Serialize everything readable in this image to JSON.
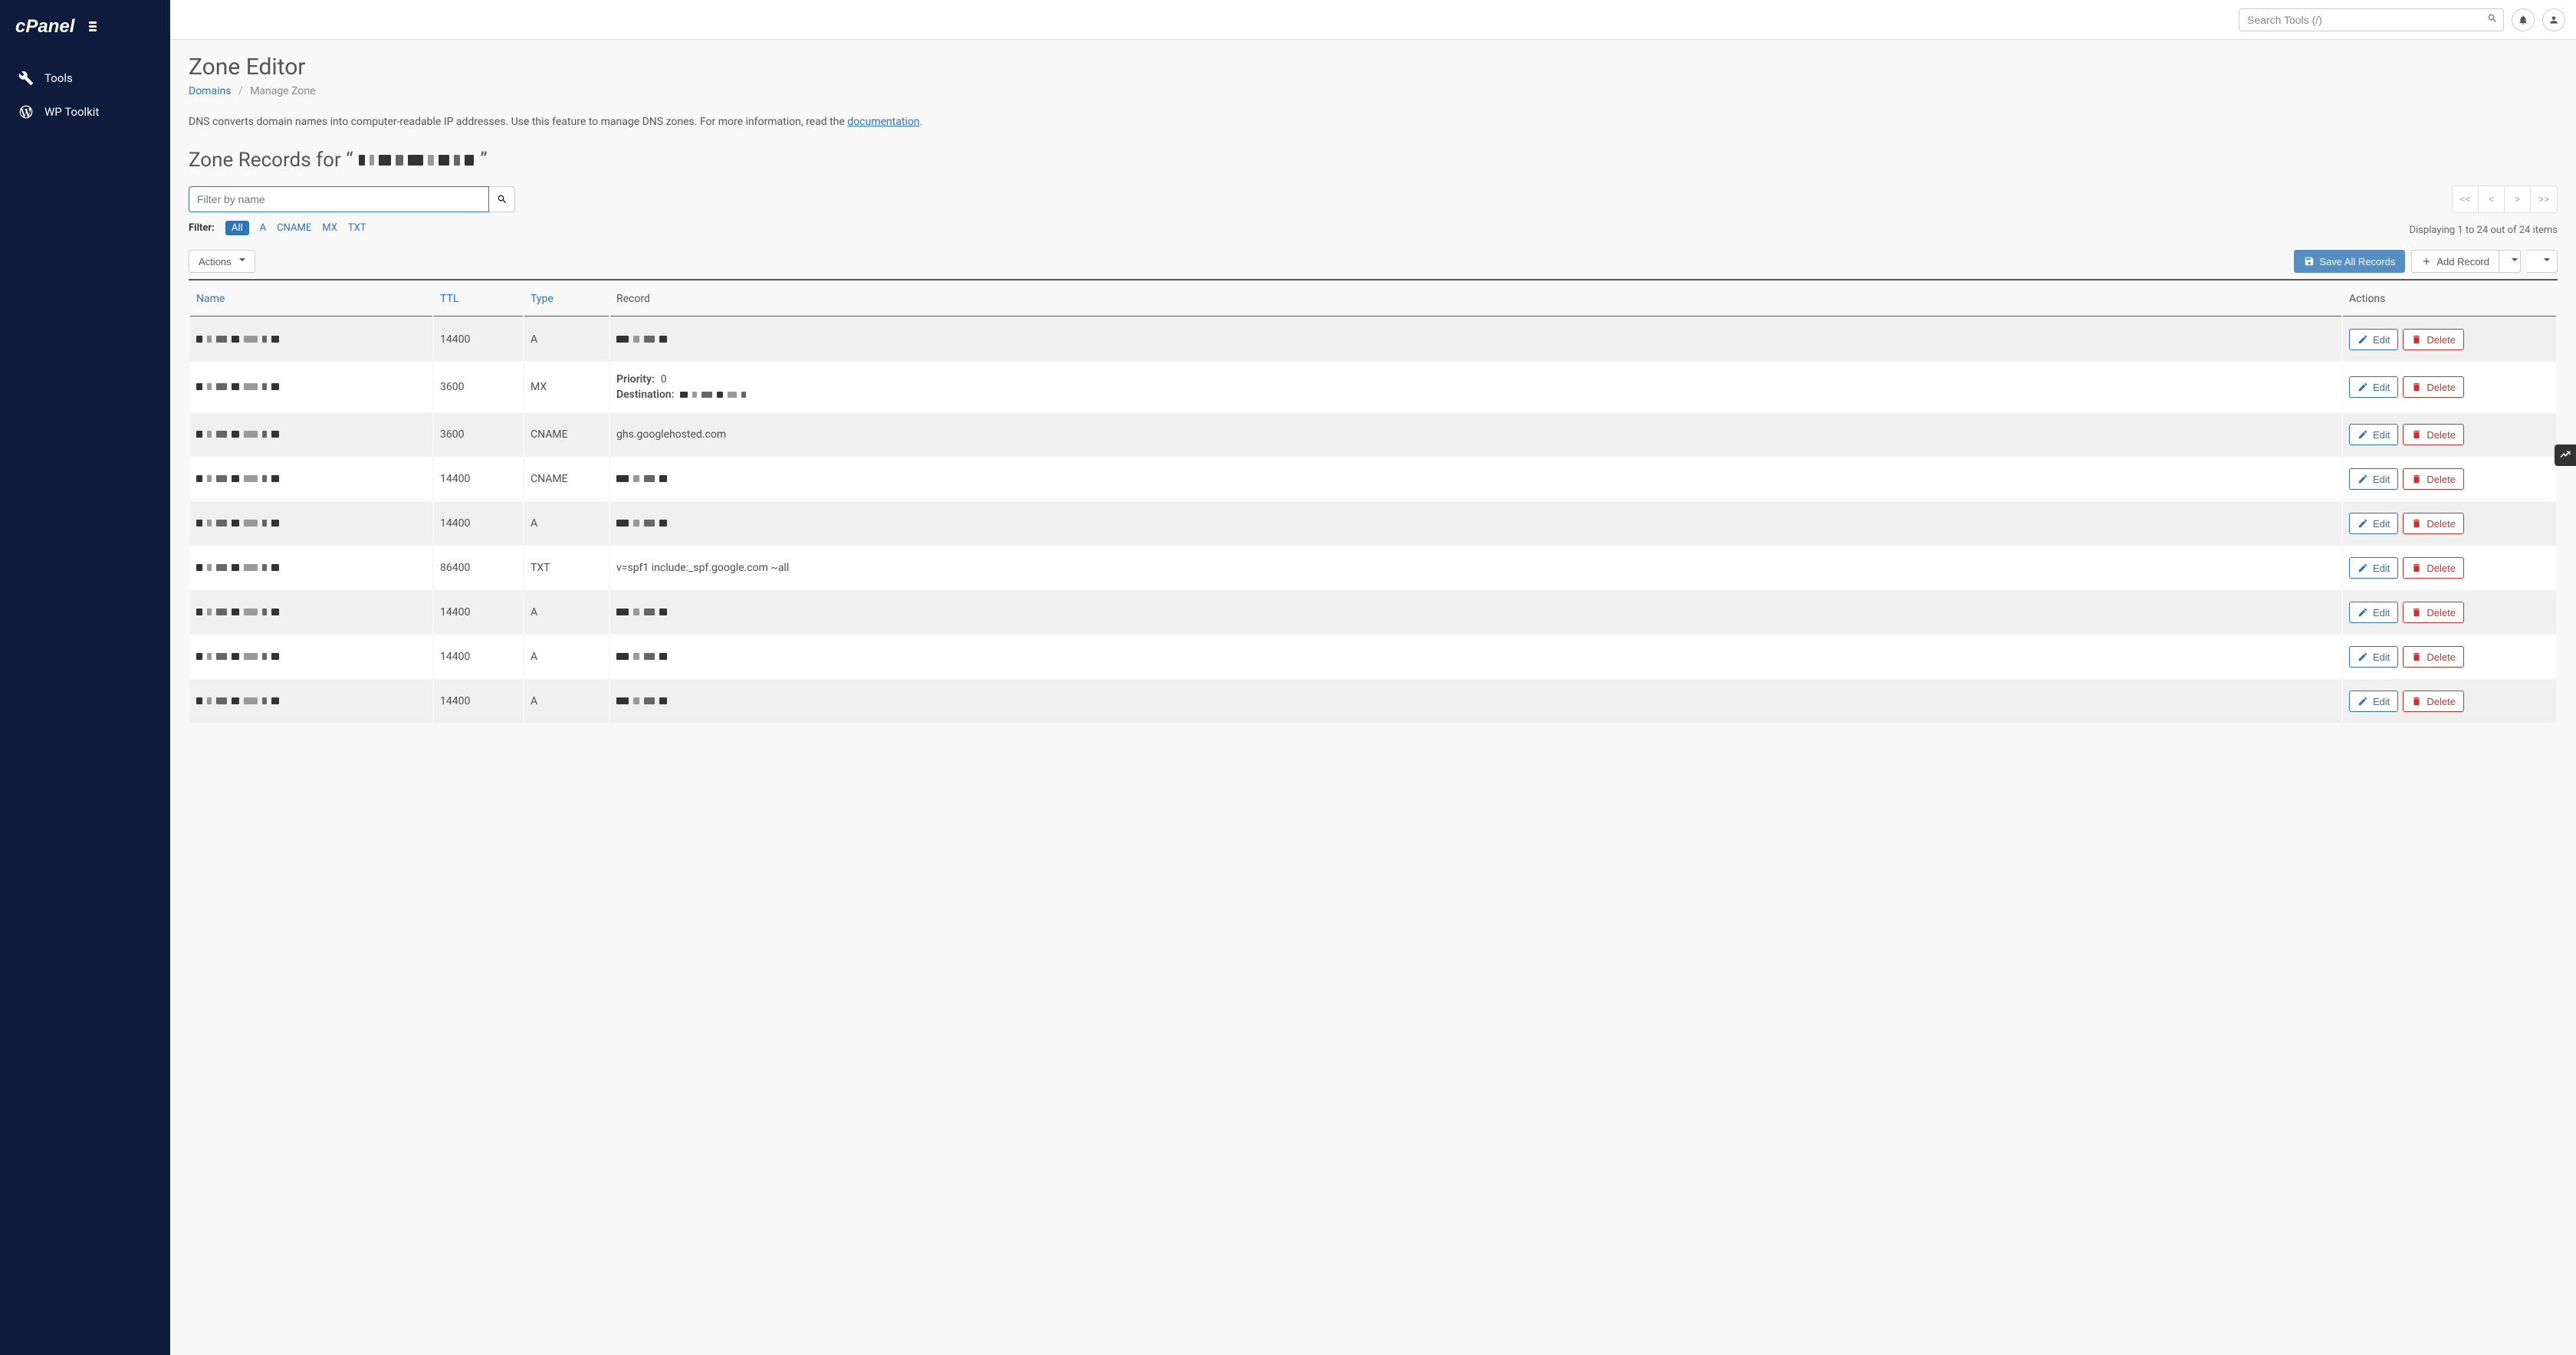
{
  "brand": "cPanel",
  "topbar": {
    "search_placeholder": "Search Tools (/)"
  },
  "sidebar": {
    "items": [
      {
        "label": "Tools",
        "icon": "tools"
      },
      {
        "label": "WP Toolkit",
        "icon": "wordpress"
      }
    ]
  },
  "page": {
    "title": "Zone Editor",
    "breadcrumb_domains": "Domains",
    "breadcrumb_current": "Manage Zone",
    "description_prefix": "DNS converts domain names into computer-readable IP addresses. Use this feature to manage DNS zones. For more information, read the ",
    "documentation_label": "documentation",
    "description_suffix": ".",
    "zone_heading_prefix": "Zone Records for “",
    "zone_heading_suffix": "”"
  },
  "filter": {
    "placeholder": "Filter by name",
    "label": "Filter:",
    "tabs": [
      "All",
      "A",
      "CNAME",
      "MX",
      "TXT"
    ],
    "active_tab": "All"
  },
  "pagination": {
    "first": "<<",
    "prev": "<",
    "next": ">",
    "last": ">>",
    "display": "Displaying 1 to 24 out of 24 items"
  },
  "toolbar": {
    "actions_label": "Actions",
    "save_all_label": "Save All Records",
    "add_record_label": "Add Record"
  },
  "table": {
    "headers": {
      "name": "Name",
      "ttl": "TTL",
      "type": "Type",
      "record": "Record",
      "actions": "Actions"
    },
    "edit_label": "Edit",
    "delete_label": "Delete",
    "priority_label": "Priority:",
    "destination_label": "Destination:",
    "rows": [
      {
        "ttl": "14400",
        "type": "A",
        "record_text": "",
        "name_redacted": true,
        "record_redacted": true
      },
      {
        "ttl": "3600",
        "type": "MX",
        "priority": "0",
        "destination_redacted": true,
        "name_redacted": true
      },
      {
        "ttl": "3600",
        "type": "CNAME",
        "record_text": "ghs.googlehosted.com",
        "name_redacted": true
      },
      {
        "ttl": "14400",
        "type": "CNAME",
        "record_text": "",
        "name_redacted": true,
        "record_redacted": true
      },
      {
        "ttl": "14400",
        "type": "A",
        "record_text": "",
        "name_redacted": true,
        "record_redacted": true
      },
      {
        "ttl": "86400",
        "type": "TXT",
        "record_text": "v=spf1 include:_spf.google.com ~all",
        "name_redacted": true
      },
      {
        "ttl": "14400",
        "type": "A",
        "record_text": "",
        "name_redacted": true,
        "record_redacted": true
      },
      {
        "ttl": "14400",
        "type": "A",
        "record_text": "",
        "name_redacted": true,
        "record_redacted": true
      },
      {
        "ttl": "14400",
        "type": "A",
        "record_text": "",
        "name_redacted": true,
        "record_redacted": true
      }
    ]
  }
}
